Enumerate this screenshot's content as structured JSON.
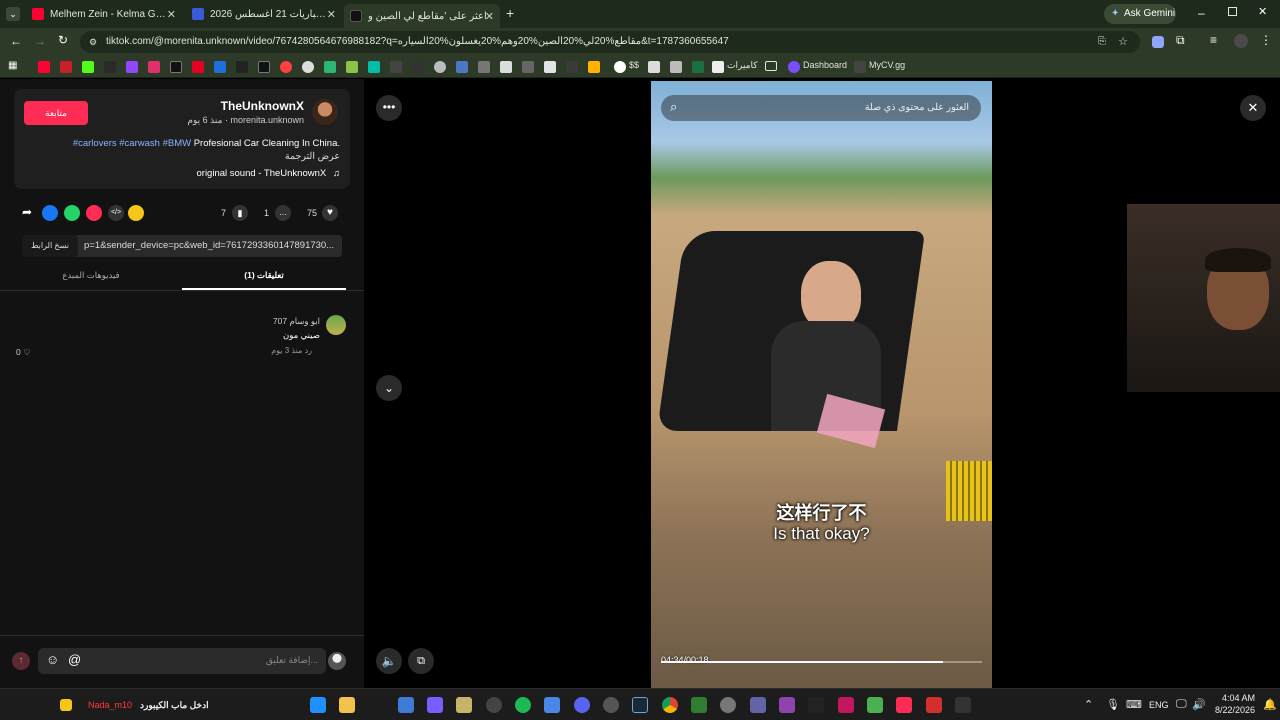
{
  "browser": {
    "tabs": [
      {
        "title": "Melhem Zein - Kelma Ghabet El",
        "favicon_color": "#ff0033",
        "active": false
      },
      {
        "title": "جدول مباريات 21 أغسطس 2026",
        "favicon_color": "#3a5ad8",
        "active": false
      },
      {
        "title": "اعثر على 'مقاطع لي الصين و",
        "favicon_color": "#111111",
        "active": true
      }
    ],
    "new_tab_label": "+",
    "ask_gemini_label": "Ask Gemini",
    "url": "tiktok.com/@morenita.unknown/video/7674280564676988182?q=مقاطع%20لي%20الصين%20وهم%20يغسلون%20السياره&t=1787360655647",
    "bookmarks": [
      {
        "label": "$$"
      },
      {
        "label": "كاميرات"
      },
      {
        "label": "Dashboard"
      },
      {
        "label": "MyCV.gg"
      }
    ]
  },
  "post": {
    "username": "TheUnknownX",
    "handle": "morenita.unknown",
    "age": "منذ 6 يوم",
    "follow_label": "متابعة",
    "caption": "Profesional Car Cleaning In China.",
    "hashtags": "#carlovers #carwash #BMW",
    "translate_label": "عرض الترجمة",
    "sound": "original sound - TheUnknownX",
    "likes": "75",
    "comments": "1",
    "saves": "7",
    "share_link": "p=1&sender_device=pc&web_id=7617293360147891730...",
    "copy_link_label": "نسخ الرابط",
    "tab_comments": "تعليقات (1)",
    "tab_creator_videos": "فيديوهات المبدع"
  },
  "comment": {
    "author": "ابو وسام 707",
    "text": "صيني مون",
    "meta": "منذ 3 يوم",
    "reply_label": "رد",
    "likes": "0"
  },
  "composer": {
    "placeholder": "إضافة تعليق..."
  },
  "video": {
    "search_placeholder": "العثور على محتوى ذي صلة",
    "subtitle_zh": "这样行了不",
    "subtitle_en": "Is that okay?",
    "time": "04:34/00:18",
    "progress": 0.88
  },
  "taskbar": {
    "user_label": "Nada_m10",
    "keyboard_hint": "ادخل ماب الكيبورد",
    "lang": "ENG",
    "time": "4:04 AM",
    "date": "8/22/2026"
  }
}
